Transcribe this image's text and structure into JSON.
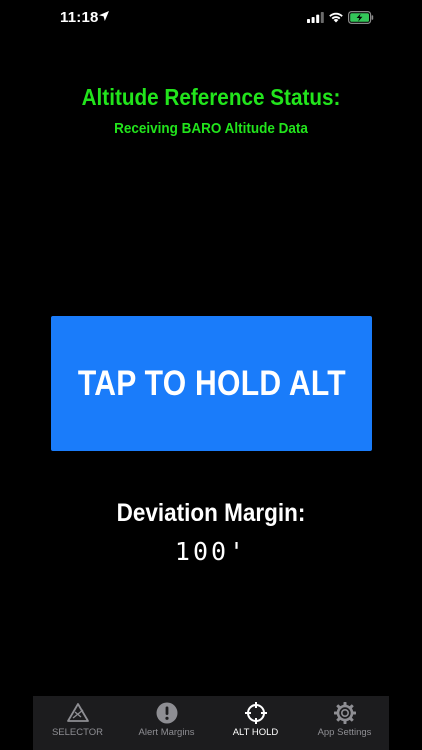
{
  "status_bar": {
    "time": "11:18",
    "icons": [
      "location-arrow-icon",
      "cellular-signal-icon",
      "wifi-icon",
      "battery-charging-icon"
    ],
    "battery_color": "#34c759"
  },
  "header": {
    "title": "Altitude Reference Status:",
    "status": "Receiving BARO Altitude Data",
    "color": "#22e41c"
  },
  "main": {
    "hold_button_label": "TAP TO HOLD ALT",
    "hold_button_color": "#1a7cfa",
    "deviation_label": "Deviation Margin:",
    "deviation_value": "100'"
  },
  "tab_bar": {
    "active_index": 2,
    "tabs": [
      {
        "label": "SELECTOR",
        "icon": "selector-warning-icon"
      },
      {
        "label": "Alert Margins",
        "icon": "exclamation-circle-icon"
      },
      {
        "label": "ALT HOLD",
        "icon": "crosshair-icon"
      },
      {
        "label": "App Settings",
        "icon": "gear-icon"
      }
    ]
  }
}
